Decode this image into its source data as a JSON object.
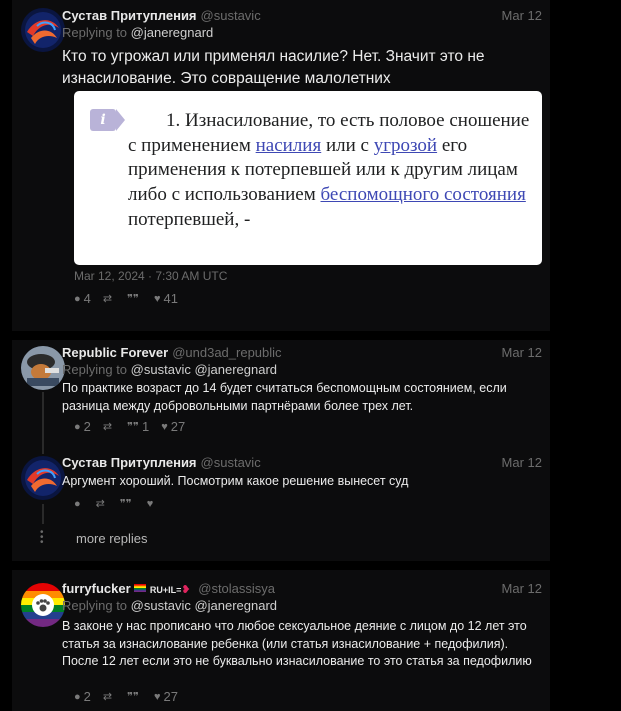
{
  "post1": {
    "author": "Сустав Притупления",
    "handle": "@sustavic",
    "date": "Mar 12",
    "replying_label": "Replying to",
    "replying_to": "@janeregnard",
    "text": "Кто то угрожал или применял насилие? Нет. Значит это не изнасилование. Это совращение малолетних",
    "quote": {
      "icon": "i",
      "number": "1.",
      "part1": "Изнасилование, то есть половое сношение с применением",
      "link1": "насилия",
      "part2": "или с",
      "link2": "угрозой",
      "part3": "его применения к потерпевшей или к другим лицам либо с использованием",
      "link3": "беспомощного состояния",
      "part4": "потерпевшей, -"
    },
    "timestamp": "Mar 12, 2024 · 7:30 AM UTC",
    "stats": {
      "comments": "4",
      "retweets": "",
      "quotes": "",
      "likes": "41"
    }
  },
  "post2": {
    "author": "Republic Forever",
    "handle": "@und3ad_republic",
    "date": "Mar 12",
    "replying_label": "Replying to",
    "replying_to": "@sustavic @janeregnard",
    "text": "По практике возраст до 14 будет считаться беспомощным состоянием, если разница между добровольными партнёрами более трех лет.",
    "stats": {
      "comments": "2",
      "retweets": "",
      "quotes": "1",
      "likes": "27"
    }
  },
  "post3": {
    "author": "Сустав Притупления",
    "handle": "@sustavic",
    "date": "Mar 12",
    "text": "Аргумент хороший. Посмотрим какое решение вынесет суд",
    "stats": {
      "comments": "",
      "retweets": "",
      "quotes": "",
      "likes": ""
    }
  },
  "more_replies": "more replies",
  "post4": {
    "author": "furryfucker",
    "badge": "RU+IL=",
    "handle": "@stolassisya",
    "date": "Mar 12",
    "replying_label": "Replying to",
    "replying_to": "@sustavic @janeregnard",
    "text": "В законе у нас прописано что любое сексуальное деяние с лицом до 12 лет это статья за изнасилование ребенка (или статья изнасилование + педофилия). После 12 лет если это не буквально изнасилование то это статья за педофилию",
    "stats": {
      "comments": "2",
      "retweets": "",
      "quotes": "",
      "likes": "27"
    }
  },
  "colors": {
    "background": "#000000",
    "panel": "#0c0c0d",
    "muted": "#6c6c6c",
    "link": "#3e48b4"
  }
}
